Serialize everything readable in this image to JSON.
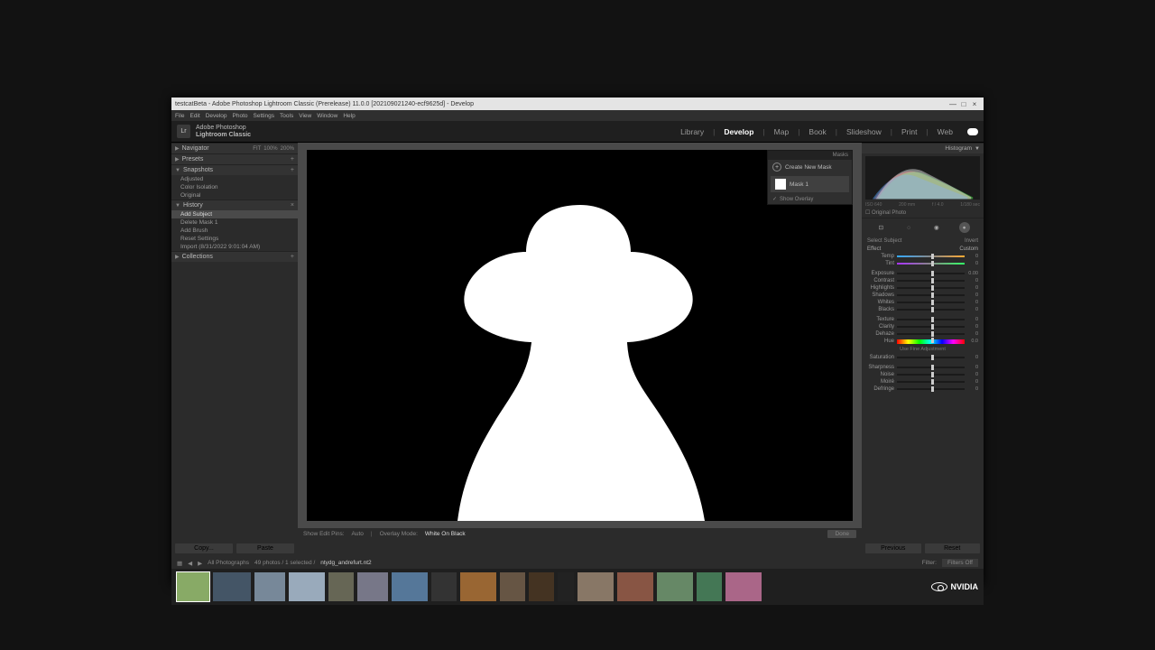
{
  "titlebar": {
    "text": "testcatBeta - Adobe Photoshop Lightroom Classic (Prerelease) 11.0.0 [202109021240-ecf9625d] - Develop"
  },
  "menubar": [
    "File",
    "Edit",
    "Develop",
    "Photo",
    "Settings",
    "Tools",
    "View",
    "Window",
    "Help"
  ],
  "brand": {
    "line1": "Adobe Photoshop",
    "line2": "Lightroom Classic",
    "logo": "Lr"
  },
  "modules": [
    "Library",
    "Develop",
    "Map",
    "Book",
    "Slideshow",
    "Print",
    "Web"
  ],
  "module_active": "Develop",
  "left": {
    "navigator": {
      "title": "Navigator",
      "opts": [
        "FIT",
        "100%",
        "200%"
      ]
    },
    "presets": {
      "title": "Presets"
    },
    "snapshots": {
      "title": "Snapshots",
      "items": [
        "Adjusted",
        "Color Isolation",
        "Original"
      ]
    },
    "history": {
      "title": "History",
      "items": [
        "Add Subject",
        "Delete Mask 1",
        "Add Brush",
        "Reset Settings",
        "Import (8/31/2022 9:01:04 AM)"
      ],
      "selected": 0
    },
    "collections": {
      "title": "Collections"
    },
    "copy": "Copy...",
    "paste": "Paste"
  },
  "canvasbar": {
    "showpins": "Show Edit Pins:",
    "auto": "Auto",
    "overlaymode": "Overlay Mode:",
    "wob": "White On Black",
    "done": "Done"
  },
  "masks": {
    "hdr": "Masks",
    "create": "Create New Mask",
    "mask1": "Mask 1",
    "overlay": "Show Overlay"
  },
  "right": {
    "histogram": {
      "title": "Histogram",
      "labels": [
        "ISO 640",
        "200 mm",
        "f / 4.0",
        "1/180 sec"
      ],
      "original": "Original Photo"
    },
    "subject": "Select Subject",
    "invert": "Invert",
    "effect_label": "Effect",
    "effect_value": "Custom",
    "sliders1": [
      {
        "lbl": "Temp",
        "val": "0",
        "g": "grad1"
      },
      {
        "lbl": "Tint",
        "val": "0",
        "g": "grad2"
      }
    ],
    "sliders2": [
      {
        "lbl": "Exposure",
        "val": "0.00"
      },
      {
        "lbl": "Contrast",
        "val": "0"
      },
      {
        "lbl": "Highlights",
        "val": "0"
      },
      {
        "lbl": "Shadows",
        "val": "0"
      },
      {
        "lbl": "Whites",
        "val": "0"
      },
      {
        "lbl": "Blacks",
        "val": "0"
      }
    ],
    "sliders3": [
      {
        "lbl": "Texture",
        "val": "0"
      },
      {
        "lbl": "Clarity",
        "val": "0"
      },
      {
        "lbl": "Dehaze",
        "val": "0"
      }
    ],
    "hue": {
      "lbl": "Hue",
      "val": "0.0"
    },
    "fine": "Use Fine Adjustment",
    "saturation": {
      "lbl": "Saturation",
      "val": "0"
    },
    "sliders4": [
      {
        "lbl": "Sharpness",
        "val": "0"
      },
      {
        "lbl": "Noise",
        "val": "0"
      },
      {
        "lbl": "Moiré",
        "val": "0"
      },
      {
        "lbl": "Defringe",
        "val": "0"
      }
    ],
    "previous": "Previous",
    "reset": "Reset"
  },
  "filmhdr": {
    "viewlabel": "All Photographs",
    "path": "49 photos / 1 selected /",
    "file": "ntydg_andrefurt.nt2",
    "filter": "Filter:",
    "filtersoff": "Filters Off"
  },
  "thumbs": [
    36,
    42,
    34,
    40,
    28,
    34,
    40,
    28,
    40,
    28,
    28,
    18,
    40,
    40,
    40,
    28,
    40
  ],
  "nvidia": "NVIDIA"
}
